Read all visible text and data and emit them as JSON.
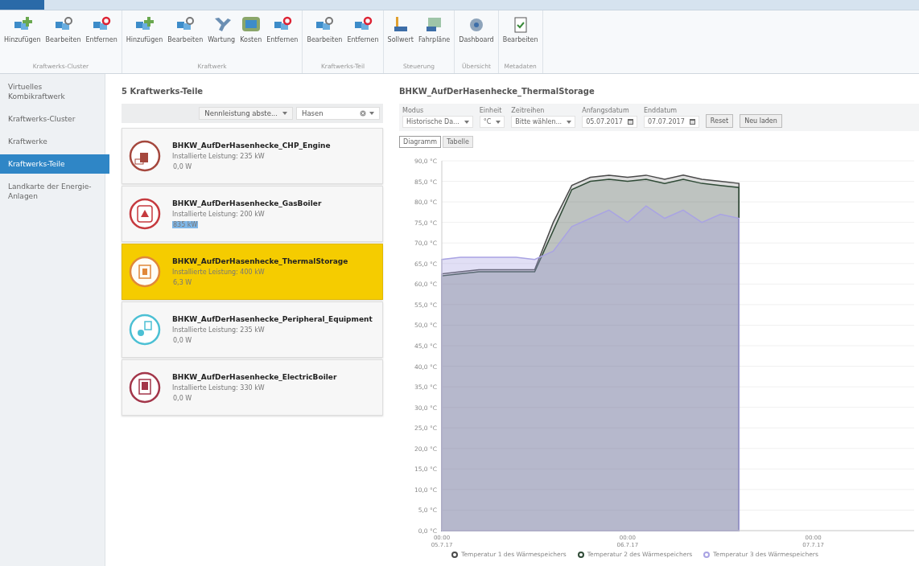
{
  "ribbon": {
    "groups": [
      {
        "label": "Kraftwerks-Cluster",
        "buttons": [
          {
            "label": "Hinzufügen",
            "kind": "add"
          },
          {
            "label": "Bearbeiten",
            "kind": "edit"
          },
          {
            "label": "Entfernen",
            "kind": "remove"
          }
        ]
      },
      {
        "label": "Kraftwerk",
        "buttons": [
          {
            "label": "Hinzufügen",
            "kind": "add"
          },
          {
            "label": "Bearbeiten",
            "kind": "edit"
          },
          {
            "label": "Wartung",
            "kind": "wrench"
          },
          {
            "label": "Kosten",
            "kind": "money"
          },
          {
            "label": "Entfernen",
            "kind": "remove"
          }
        ]
      },
      {
        "label": "Kraftwerks-Teil",
        "buttons": [
          {
            "label": "Bearbeiten",
            "kind": "edit"
          },
          {
            "label": "Entfernen",
            "kind": "remove"
          }
        ]
      },
      {
        "label": "Steuerung",
        "buttons": [
          {
            "label": "Sollwert",
            "kind": "setpoint"
          },
          {
            "label": "Fahrpläne",
            "kind": "schedule"
          }
        ]
      },
      {
        "label": "Übersicht",
        "buttons": [
          {
            "label": "Dashboard",
            "kind": "dashboard"
          }
        ]
      },
      {
        "label": "Metadaten",
        "buttons": [
          {
            "label": "Bearbeiten",
            "kind": "clipboard"
          }
        ]
      }
    ]
  },
  "sidebar": {
    "items": [
      {
        "label": "Virtuelles Kombikraftwerk",
        "selected": false
      },
      {
        "label": "Kraftwerks-Cluster",
        "selected": false
      },
      {
        "label": "Kraftwerke",
        "selected": false
      },
      {
        "label": "Kraftwerks-Teile",
        "selected": true
      },
      {
        "label": "Landkarte der Energie-Anlagen",
        "selected": false
      }
    ]
  },
  "parts": {
    "title": "5 Kraftwerks-Teile",
    "sort": "Nennleistung abste...",
    "search": "Hasen",
    "items": [
      {
        "name": "BHKW_AufDerHasenhecke_CHP_Engine",
        "capacity": "Installierte Leistung: 235 kW",
        "reading": "0,0 W",
        "kind": "engine",
        "color": "#a5483e",
        "selected": false,
        "highlighted": false
      },
      {
        "name": "BHKW_AufDerHasenhecke_GasBoiler",
        "capacity": "Installierte Leistung: 200 kW",
        "reading": "835 kW",
        "kind": "flame",
        "color": "#c63a3f",
        "selected": false,
        "highlighted": true
      },
      {
        "name": "BHKW_AufDerHasenhecke_ThermalStorage",
        "capacity": "Installierte Leistung: 400 kW",
        "reading": "6,3 W",
        "kind": "tank",
        "color": "#e0883a",
        "selected": true,
        "highlighted": false
      },
      {
        "name": "BHKW_AufDerHasenhecke_Peripheral_Equipment",
        "capacity": "Installierte Leistung: 235 kW",
        "reading": "0,0 W",
        "kind": "gears",
        "color": "#4cc0d4",
        "selected": false,
        "highlighted": false
      },
      {
        "name": "BHKW_AufDerHasenhecke_ElectricBoiler",
        "capacity": "Installierte Leistung: 330 kW",
        "reading": "0,0 W",
        "kind": "heater",
        "color": "#a3364a",
        "selected": false,
        "highlighted": false
      }
    ]
  },
  "detail": {
    "title": "BHKW_AufDerHasenhecke_ThermalStorage",
    "controls": [
      {
        "label": "Modus",
        "value": "Historische Da...",
        "kind": "select"
      },
      {
        "label": "Einheit",
        "value": "°C",
        "kind": "select"
      },
      {
        "label": "Zeitreihen",
        "value": "Bitte wählen...",
        "kind": "select"
      },
      {
        "label": "Anfangsdatum",
        "value": "05.07.2017",
        "kind": "date"
      },
      {
        "label": "Enddatum",
        "value": "07.07.2017",
        "kind": "date"
      }
    ],
    "buttons": [
      "Reset",
      "Neu laden"
    ],
    "tabs": [
      {
        "label": "Diagramm",
        "selected": true
      },
      {
        "label": "Tabelle",
        "selected": false
      }
    ],
    "chart_data": {
      "type": "area",
      "categories": [
        "00:00 05.7.17",
        null,
        null,
        null,
        null,
        null,
        null,
        null,
        null,
        null,
        "00:00 06.7.17",
        null,
        null,
        null,
        null,
        null,
        null,
        null,
        null,
        null,
        "00:00 07.7.17",
        null,
        null,
        null,
        null,
        null
      ],
      "series": [
        {
          "name": "Temperatur 1 des Wärmespeichers",
          "color": "#4a4a4a",
          "values": [
            62.5,
            63,
            63.5,
            63.5,
            63.5,
            63.5,
            75,
            84,
            86,
            86.5,
            86,
            86.5,
            85.5,
            86.5,
            85.5,
            85,
            84.5,
            null,
            null,
            null,
            null,
            null,
            null,
            null,
            null,
            null
          ]
        },
        {
          "name": "Temperatur 2 des Wärmespeichers",
          "color": "#2f4a36",
          "values": [
            62,
            62.5,
            63,
            63,
            63,
            63,
            73,
            83,
            85,
            85.5,
            85,
            85.5,
            84.5,
            85.5,
            84.5,
            84,
            83.5,
            null,
            null,
            null,
            null,
            null,
            null,
            null,
            null,
            null
          ]
        },
        {
          "name": "Temperatur 3 des Wärmespeichers",
          "color": "#a9a3e3",
          "values": [
            66,
            66.5,
            66.5,
            66.5,
            66.5,
            66,
            68,
            74,
            76,
            78,
            75,
            79,
            76,
            78,
            75,
            77,
            76,
            null,
            null,
            null,
            null,
            null,
            null,
            null,
            null,
            null
          ]
        }
      ],
      "ylim": [
        0,
        90
      ],
      "yticks": [
        {
          "value": 0,
          "label": "0,0 °C"
        },
        {
          "value": 5,
          "label": "5,0 °C"
        },
        {
          "value": 10,
          "label": "10,0 °C"
        },
        {
          "value": 15,
          "label": "15,0 °C"
        },
        {
          "value": 20,
          "label": "20,0 °C"
        },
        {
          "value": 25,
          "label": "25,0 °C"
        },
        {
          "value": 30,
          "label": "30,0 °C"
        },
        {
          "value": 35,
          "label": "35,0 °C"
        },
        {
          "value": 40,
          "label": "40,0 °C"
        },
        {
          "value": 45,
          "label": "45,0 °C"
        },
        {
          "value": 50,
          "label": "50,0 °C"
        },
        {
          "value": 55,
          "label": "55,0 °C"
        },
        {
          "value": 60,
          "label": "60,0 °C"
        },
        {
          "value": 65,
          "label": "65,0 °C"
        },
        {
          "value": 70,
          "label": "70,0 °C"
        },
        {
          "value": 75,
          "label": "75,0 °C"
        },
        {
          "value": 80,
          "label": "80,0 °C"
        },
        {
          "value": 85,
          "label": "85,0 °C"
        },
        {
          "value": 90,
          "label": "90,0 °C"
        }
      ],
      "grid": true
    }
  }
}
